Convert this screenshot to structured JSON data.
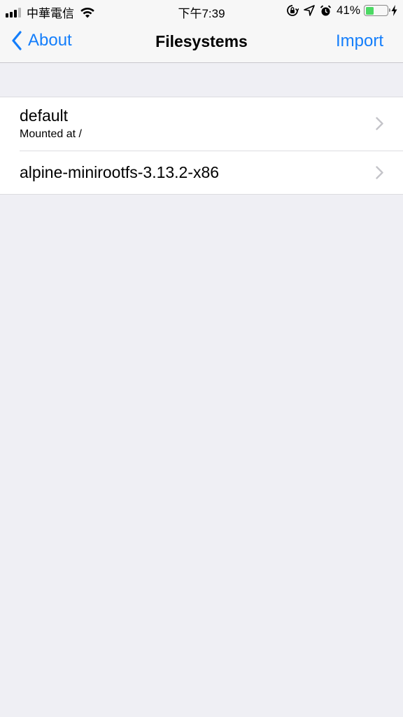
{
  "status_bar": {
    "carrier": "中華電信",
    "time": "下午7:39",
    "battery_percent": "41%",
    "battery_level": 0.41,
    "signal_bars": 3,
    "icons": [
      "signal-icon",
      "wifi-icon",
      "orientation-lock-icon",
      "location-arrow-icon",
      "alarm-icon",
      "battery-icon",
      "charging-bolt-icon"
    ]
  },
  "nav": {
    "back_label": "About",
    "title": "Filesystems",
    "action_label": "Import",
    "accent_color": "#147efb"
  },
  "filesystems": [
    {
      "name": "default",
      "subtitle": "Mounted at /"
    },
    {
      "name": "alpine-minirootfs-3.13.2-x86",
      "subtitle": ""
    }
  ]
}
